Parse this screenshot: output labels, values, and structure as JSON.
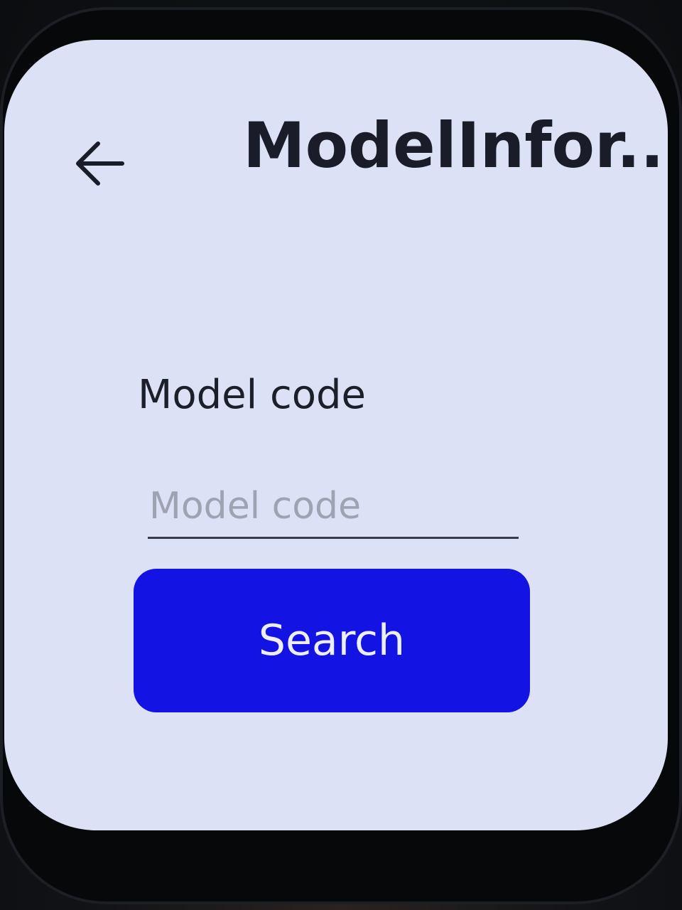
{
  "header": {
    "title": "ModelInfor...",
    "back_icon": "arrow-left-icon"
  },
  "form": {
    "label": "Model code",
    "input": {
      "value": "",
      "placeholder": "Model code"
    },
    "search_label": "Search"
  },
  "colors": {
    "screen_background": "#dde1f6",
    "button_background": "#1313e4",
    "button_text": "#eceefb",
    "text": "#1c1e2a",
    "placeholder": "#9fa2b0"
  }
}
